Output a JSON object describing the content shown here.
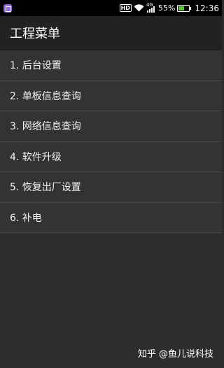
{
  "status_bar": {
    "hd_label": "HD",
    "network_label": "4G",
    "battery_percent_text": "55%",
    "battery_level": 0.55,
    "time": "12:36",
    "battery_color": "#62c23a",
    "notification_icon_color": "#8e6bd6"
  },
  "header": {
    "title": "工程菜单"
  },
  "menu": {
    "items": [
      {
        "label": "1. 后台设置"
      },
      {
        "label": "2. 单板信息查询"
      },
      {
        "label": "3. 网络信息查询"
      },
      {
        "label": "4. 软件升级"
      },
      {
        "label": "5. 恢复出厂设置"
      },
      {
        "label": "6. 补电"
      }
    ]
  },
  "watermark": {
    "text": "知乎 @鱼儿说科技"
  }
}
